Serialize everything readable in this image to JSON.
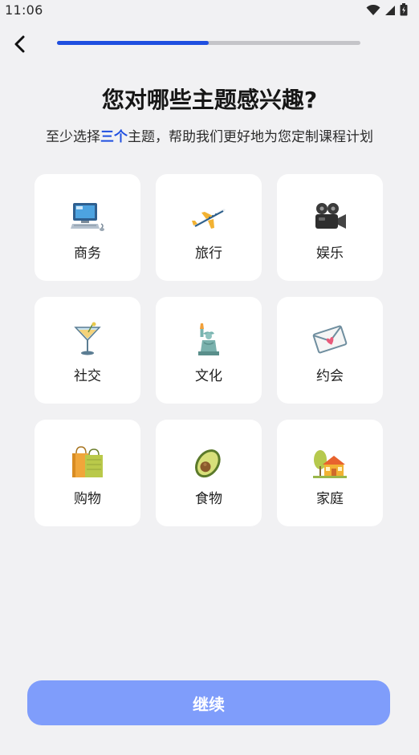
{
  "status_bar": {
    "time": "11:06",
    "icons": [
      "wifi-icon",
      "signal-icon",
      "battery-icon"
    ]
  },
  "header": {
    "back_icon": "chevron-left-icon",
    "progress": 0.5
  },
  "title": "您对哪些主题感兴趣?",
  "subtitle": {
    "before": "至少选择",
    "highlight": "三个",
    "after": "主题，帮助我们更好地为您定制课程计划"
  },
  "topics": [
    {
      "label": "商务",
      "icon": "computer-icon"
    },
    {
      "label": "旅行",
      "icon": "airplane-icon"
    },
    {
      "label": "娱乐",
      "icon": "movie-camera-icon"
    },
    {
      "label": "社交",
      "icon": "cocktail-icon"
    },
    {
      "label": "文化",
      "icon": "statue-of-liberty-icon"
    },
    {
      "label": "约会",
      "icon": "love-letter-icon"
    },
    {
      "label": "购物",
      "icon": "shopping-bags-icon"
    },
    {
      "label": "食物",
      "icon": "avocado-icon"
    },
    {
      "label": "家庭",
      "icon": "house-icon"
    }
  ],
  "continue_label": "继续",
  "colors": {
    "accent": "#1f4fe0",
    "button_disabled": "#7f9dfb",
    "background": "#f1f1f3",
    "card": "#ffffff"
  }
}
